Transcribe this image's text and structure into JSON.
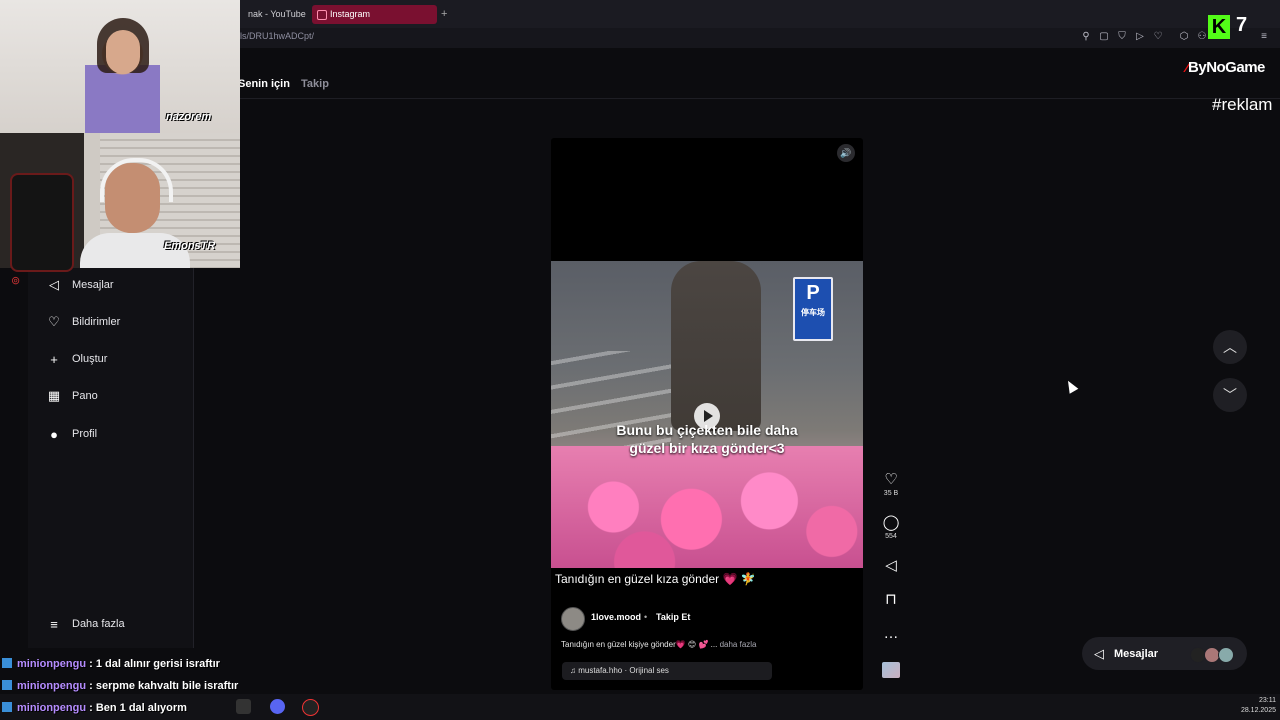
{
  "browser": {
    "tabs": [
      {
        "label": "nak - YouTube"
      },
      {
        "label": "Instagram"
      }
    ],
    "new_tab_icon": "plus-icon",
    "url": "ls/DRU1hwADCpt/",
    "toolbar_icons": [
      "pin-icon",
      "screenshot-icon",
      "shield-icon",
      "play-icon",
      "heart-icon",
      "extensions-icon",
      "account-icon",
      "menu-icon"
    ]
  },
  "feed_tabs": {
    "for_you": "Senin için",
    "following": "Takip"
  },
  "sidebar": {
    "items": [
      {
        "label": "Mesajlar",
        "icon": "send-icon"
      },
      {
        "label": "Bildirimler",
        "icon": "heart-icon"
      },
      {
        "label": "Oluştur",
        "icon": "plus-icon"
      },
      {
        "label": "Pano",
        "icon": "dashboard-icon"
      },
      {
        "label": "Profil",
        "icon": "avatar-icon"
      }
    ],
    "more": "Daha fazla"
  },
  "reel": {
    "video_caption_line1": "Bunu bu çiçekten bile daha",
    "video_caption_line2": "güzel bir kıza gönder<3",
    "parking_sign": "P",
    "parking_sign_sub": "停车场",
    "title": "Tanıdığın en güzel kıza gönder 💗 🧚",
    "author": "1love.mood",
    "dot": "•",
    "follow": "Takip Et",
    "description": "Tanıdığın en güzel kişiye gönder💗 😊 💕 ...",
    "more": "daha fazla",
    "audio": "♫ mustafa.hho · Orijinal ses"
  },
  "actions": {
    "likes": "35 B",
    "comments": "554"
  },
  "messages_pill": {
    "label": "Mesajlar"
  },
  "webcams": {
    "cam1_label": "nazorem",
    "cam2_label": "EmonsTR"
  },
  "overlays": {
    "kick_letter": "K",
    "kick_number": "7",
    "sponsor": "ByNoGame",
    "sponsor_mark": "⁄",
    "reklam": "#reklam"
  },
  "chat": [
    {
      "user": "minionpengu",
      "message": ": 1 dal alınır gerisi israftır"
    },
    {
      "user": "minionpengu",
      "message": ": serpme kahvaltı bile israftır"
    },
    {
      "user": "minionpengu",
      "message": ": Ben 1 dal alıyorm"
    }
  ],
  "taskbar": {
    "time": "23:11",
    "date": "28.12.2025"
  },
  "colors": {
    "instagram_tab": "#7a1030",
    "kick_green": "#53fc18",
    "chat_user": "#b58cff",
    "background": "#0c0c0f"
  }
}
